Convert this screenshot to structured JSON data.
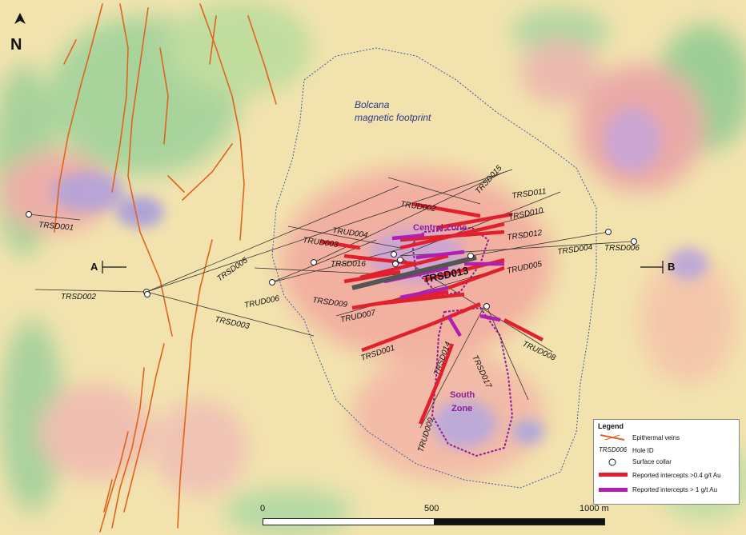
{
  "map": {
    "footprint_label_line1": "Bolcana",
    "footprint_label_line2": "magnetic footprint",
    "north_arrow": "N",
    "section_start": "A",
    "section_end": "B",
    "zones": {
      "central": "Central Zone",
      "south_line1": "South",
      "south_line2": "Zone"
    },
    "holes": [
      {
        "id": "TRSD001"
      },
      {
        "id": "TRSD002"
      },
      {
        "id": "TRSD003"
      },
      {
        "id": "TRSD004"
      },
      {
        "id": "TRSD005"
      },
      {
        "id": "TRSD006"
      },
      {
        "id": "TRSD009"
      },
      {
        "id": "TRSD010"
      },
      {
        "id": "TRSD011"
      },
      {
        "id": "TRSD012"
      },
      {
        "id": "TRSD013"
      },
      {
        "id": "TRSD014"
      },
      {
        "id": "TRSD015"
      },
      {
        "id": "TRSD016"
      },
      {
        "id": "TRSD017"
      },
      {
        "id": "TRUD001"
      },
      {
        "id": "TRUD002"
      },
      {
        "id": "TRUD003"
      },
      {
        "id": "TRUD004"
      },
      {
        "id": "TRUD005"
      },
      {
        "id": "TRUD006"
      },
      {
        "id": "TRUD007"
      },
      {
        "id": "TRUD008"
      },
      {
        "id": "TRUD009"
      }
    ],
    "colors": {
      "vein": "#e0641e",
      "intercept_04": "#e0202c",
      "intercept_1": "#b01fb0",
      "footprint": "#3a5aa8"
    }
  },
  "legend": {
    "title": "Legend",
    "items": [
      {
        "label": "Epithermal veins",
        "icon": "vein-icon"
      },
      {
        "label": "Hole ID",
        "sample": "TRSD006",
        "icon": "hole-id-sample"
      },
      {
        "label": "Surface collar",
        "icon": "collar-icon"
      },
      {
        "label": "Reported intercepts >0.4 g/t Au",
        "icon": "red-bar-icon"
      },
      {
        "label": "Reported intercepts > 1 g/t Au",
        "icon": "purple-bar-icon"
      }
    ]
  },
  "scale_bar": {
    "labels": [
      "0",
      "500",
      "1000 m"
    ]
  }
}
